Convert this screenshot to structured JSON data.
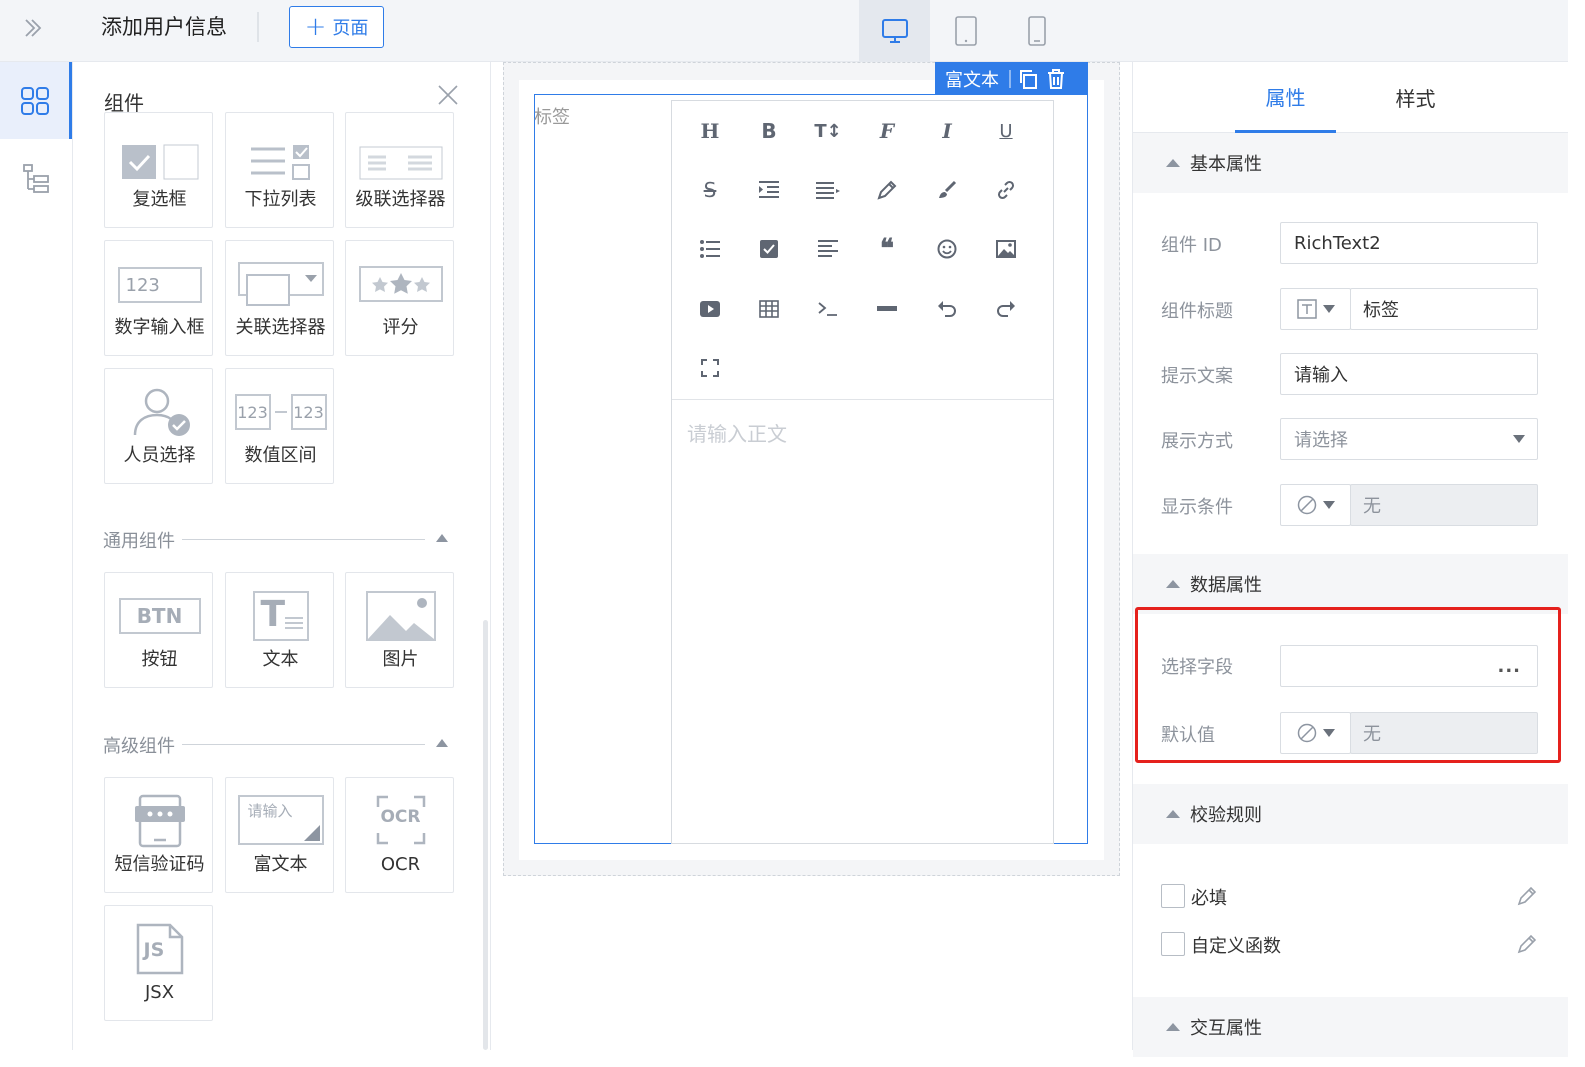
{
  "topbar": {
    "expand_icon": "double-chevron-right-icon",
    "page_title": "添加用户信息",
    "add_page_label": "页面",
    "devices": [
      "desktop-icon",
      "tablet-icon",
      "mobile-icon"
    ],
    "active_device": "desktop"
  },
  "rail": {
    "items": [
      {
        "name": "components",
        "icon": "grid-icon",
        "active": true
      },
      {
        "name": "outline",
        "icon": "tree-icon",
        "active": false
      }
    ]
  },
  "components_panel": {
    "title": "组件",
    "form_components": [
      {
        "label": "复选框",
        "icon": "checkbox-icon"
      },
      {
        "label": "下拉列表",
        "icon": "dropdown-list-icon"
      },
      {
        "label": "级联选择器",
        "icon": "cascader-icon"
      },
      {
        "label": "数字输入框",
        "icon": "number-input-icon",
        "text": "123"
      },
      {
        "label": "关联选择器",
        "icon": "relation-select-icon"
      },
      {
        "label": "评分",
        "icon": "rating-icon"
      },
      {
        "label": "人员选择",
        "icon": "person-select-icon"
      },
      {
        "label": "数值区间",
        "icon": "number-range-icon",
        "text_a": "123",
        "text_b": "123"
      }
    ],
    "common_section": {
      "title": "通用组件",
      "items": [
        {
          "label": "按钮",
          "icon": "button-icon",
          "text": "BTN"
        },
        {
          "label": "文本",
          "icon": "text-icon",
          "text": "T"
        },
        {
          "label": "图片",
          "icon": "image-icon"
        }
      ]
    },
    "advanced_section": {
      "title": "高级组件",
      "items": [
        {
          "label": "短信验证码",
          "icon": "sms-code-icon"
        },
        {
          "label": "富文本",
          "icon": "richtext-icon",
          "text": "请输入"
        },
        {
          "label": "OCR",
          "icon": "ocr-icon",
          "text": "OCR"
        },
        {
          "label": "JSX",
          "icon": "jsx-icon",
          "text": "JS"
        }
      ]
    }
  },
  "canvas": {
    "field_label": "标签",
    "selected_tag": "富文本",
    "tag_icons": [
      "copy-icon",
      "trash-icon"
    ],
    "editor": {
      "toolbar": [
        "H",
        "B",
        "T↕",
        "F",
        "I",
        "U",
        "S",
        "indent-icon",
        "align-icon",
        "pen-icon",
        "brush-icon",
        "link-icon",
        "list-icon",
        "check-icon",
        "paragraph-icon",
        "quote-icon",
        "emoji-icon",
        "image-icon",
        "video-icon",
        "table-icon",
        "code-icon",
        "hr-icon",
        "undo-icon",
        "redo-icon",
        "fullscreen-icon"
      ],
      "placeholder": "请输入正文"
    }
  },
  "properties": {
    "tabs": [
      "属性",
      "样式"
    ],
    "active_tab": "属性",
    "basic": {
      "title": "基本属性",
      "fields": [
        {
          "label": "组件 ID",
          "value": "RichText2"
        },
        {
          "label": "组件标题",
          "value": "标签"
        },
        {
          "label": "提示文案",
          "value": "请输入"
        },
        {
          "label": "展示方式",
          "value": "请选择"
        },
        {
          "label": "显示条件",
          "value": "无"
        }
      ]
    },
    "data": {
      "title": "数据属性",
      "fields": [
        {
          "label": "选择字段",
          "value": "..."
        },
        {
          "label": "默认值",
          "value": "无"
        }
      ]
    },
    "validation": {
      "title": "校验规则",
      "rules": [
        {
          "label": "必填",
          "checked": false
        },
        {
          "label": "自定义函数",
          "checked": false
        }
      ]
    },
    "interaction": {
      "title": "交互属性"
    }
  },
  "colors": {
    "accent": "#2f7ce8",
    "highlight": "#e5211d"
  }
}
